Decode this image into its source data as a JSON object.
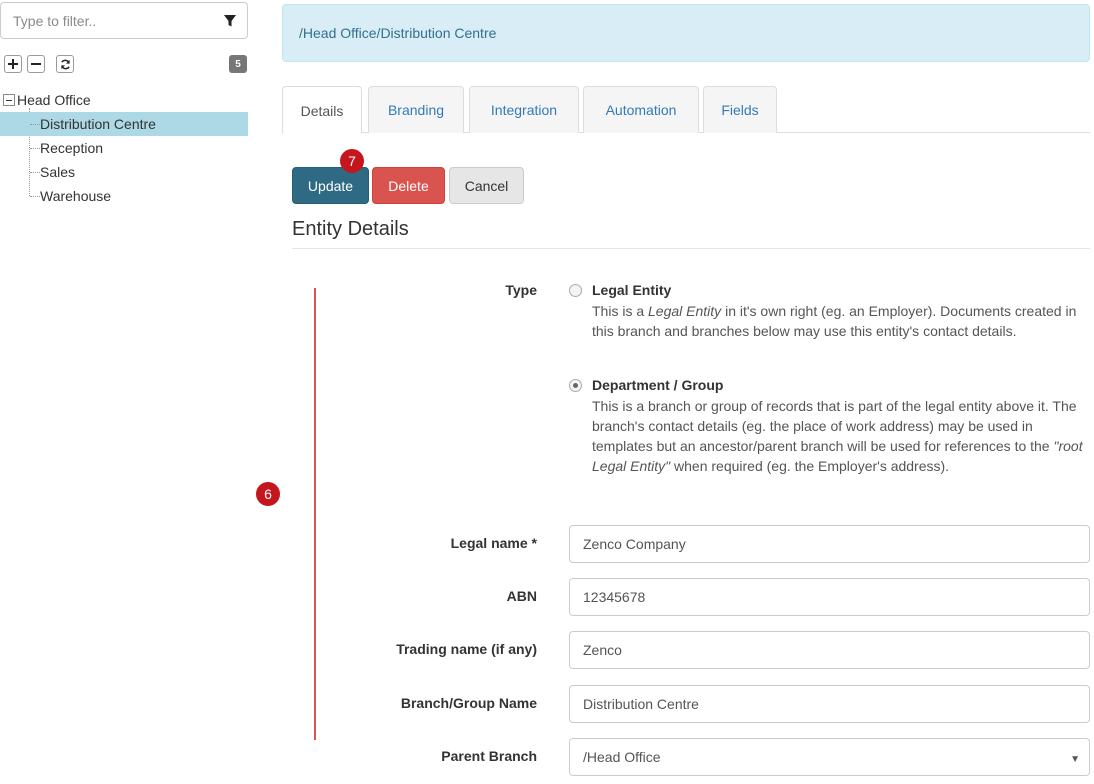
{
  "sidebar": {
    "filter_placeholder": "Type to filter..",
    "count_badge": "5",
    "tree": {
      "root": "Head Office",
      "children": [
        "Distribution Centre",
        "Reception",
        "Sales",
        "Warehouse"
      ],
      "selected": "Distribution Centre"
    }
  },
  "breadcrumb": "/Head Office/Distribution Centre",
  "tabs": [
    "Details",
    "Branding",
    "Integration",
    "Automation",
    "Fields"
  ],
  "active_tab": "Details",
  "actions": {
    "update": "Update",
    "delete": "Delete",
    "cancel": "Cancel"
  },
  "markers": {
    "update_marker": "7",
    "form_marker": "6"
  },
  "section_title": "Entity Details",
  "form": {
    "type_label": "Type",
    "type_options": [
      {
        "title": "Legal Entity",
        "desc_before": "This is a ",
        "desc_em": "Legal Entity",
        "desc_after": " in it's own right (eg. an Employer). Documents created in this branch and branches below may use this entity's contact details.",
        "checked": false
      },
      {
        "title": "Department / Group",
        "desc_before": "This is a branch or group of records that is part of the legal entity above it. The branch's contact details (eg. the place of work address) may be used in templates but an ancestor/parent branch will be used for references to the ",
        "desc_em": "\"root Legal Entity\"",
        "desc_after": " when required (eg. the Employer's address).",
        "checked": true
      }
    ],
    "legal_name_label": "Legal name *",
    "legal_name_value": "Zenco Company",
    "abn_label": "ABN",
    "abn_value": "12345678",
    "trading_name_label": "Trading name (if any)",
    "trading_name_value": "Zenco",
    "branch_name_label": "Branch/Group Name",
    "branch_name_value": "Distribution Centre",
    "parent_branch_label": "Parent Branch",
    "parent_branch_value": "/Head Office"
  },
  "colors": {
    "update_button": "#2e6a84",
    "delete_button": "#d9534f",
    "breadcrumb_bg": "#d9edf7",
    "selected_tree_item": "#add8e6",
    "marker": "#c4161c",
    "annotation_line": "#e05252"
  }
}
